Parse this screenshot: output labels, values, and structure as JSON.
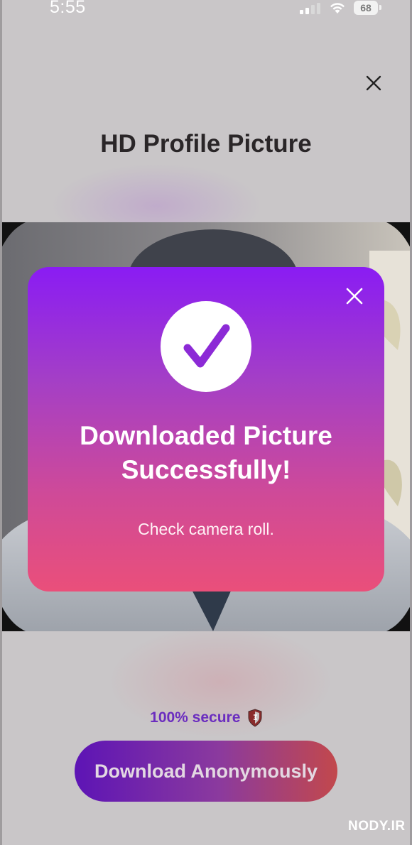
{
  "status_bar": {
    "time": "5:55",
    "battery": "68",
    "icons": [
      "signal-icon",
      "wifi-icon",
      "battery-icon"
    ]
  },
  "header": {
    "title": "HD Profile Picture",
    "close_icon": "close-icon"
  },
  "modal": {
    "icon": "checkmark-icon",
    "title_line1": "Downloaded Picture",
    "title_line2": "Successfully!",
    "subtitle": "Check camera roll.",
    "close_icon": "close-icon"
  },
  "footer": {
    "secure_text": "100% secure",
    "secure_icon": "shield-icon",
    "download_label": "Download Anonymously"
  },
  "watermark": {
    "text": "NODY.IR"
  },
  "colors": {
    "modal_top": "#8a1cf3",
    "modal_bottom": "#ea4f7a",
    "button_start": "#5d14b5",
    "button_end": "#c2484c",
    "secure_text": "#6b2dbf"
  }
}
